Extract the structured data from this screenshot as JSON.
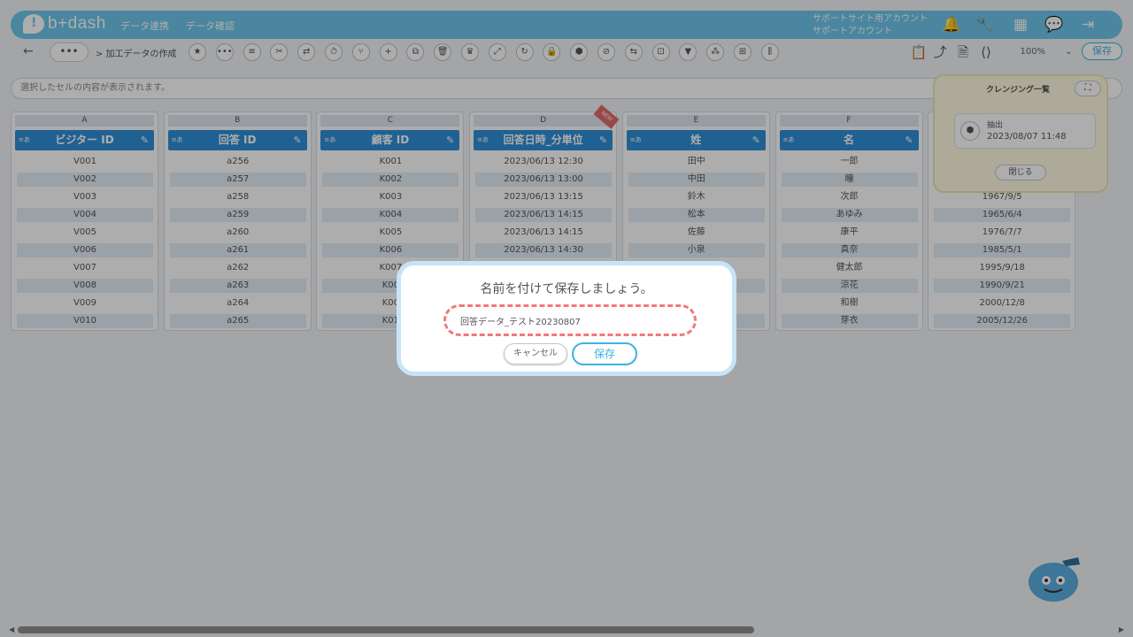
{
  "header": {
    "logo_text": "b+dash",
    "nav": [
      "データ連携",
      "データ確認"
    ],
    "account_line1": "サポートサイト用アカウント",
    "account_line2": "サポートアカウント"
  },
  "toolbar": {
    "back": "←",
    "more": "•••",
    "breadcrumb": "> 加工データの作成",
    "zoom": "100%",
    "save_label": "保存",
    "tool_icons": [
      "star-icon",
      "more-icon",
      "list-icon",
      "scissors-icon",
      "split-icon",
      "timer-icon",
      "merge-icon",
      "plus-icon",
      "copy-icon",
      "trash-icon",
      "crown-icon",
      "expand-icon",
      "repeat-icon",
      "lock-icon",
      "box-icon",
      "cancel-icon",
      "swap-icon",
      "grid-icon",
      "filter-icon",
      "pattern-icon",
      "table-icon",
      "columns-icon"
    ]
  },
  "cellbar": {
    "placeholder": "選択したセルの内容が表示されます。"
  },
  "columns": [
    {
      "letter": "A",
      "kind": "A",
      "name": "ビジター ID",
      "values": [
        "V001",
        "V002",
        "V003",
        "V004",
        "V005",
        "V006",
        "V007",
        "V008",
        "V009",
        "V010"
      ]
    },
    {
      "letter": "B",
      "kind": "A",
      "name": "回答 ID",
      "values": [
        "a256",
        "a257",
        "a258",
        "a259",
        "a260",
        "a261",
        "a262",
        "a263",
        "a264",
        "a265"
      ]
    },
    {
      "letter": "C",
      "kind": "A",
      "name": "顧客 ID",
      "values": [
        "K001",
        "K002",
        "K003",
        "K004",
        "K005",
        "K006",
        "K007",
        "K00",
        "K00",
        "K01"
      ]
    },
    {
      "letter": "D",
      "kind": "A",
      "name": "回答日時_分単位",
      "new_badge": "NEW",
      "values": [
        "2023/06/13 12:30",
        "2023/06/13 13:00",
        "2023/06/13 13:15",
        "2023/06/13 14:15",
        "2023/06/13 14:15",
        "2023/06/13 14:30",
        "",
        "",
        "",
        ""
      ]
    },
    {
      "letter": "E",
      "kind": "A",
      "name": "姓",
      "values": [
        "田中",
        "中田",
        "鈴木",
        "松本",
        "佐藤",
        "小泉",
        "",
        "",
        "",
        ""
      ]
    },
    {
      "letter": "F",
      "kind": "A",
      "name": "名",
      "values": [
        "一郎",
        "瞳",
        "次郎",
        "あゆみ",
        "康平",
        "真奈",
        "健太郎",
        "涼花",
        "和樹",
        "芽衣"
      ]
    },
    {
      "letter": "",
      "kind": "",
      "name": "",
      "values": [
        "",
        "",
        "1967/9/5",
        "1965/6/4",
        "1976/7/7",
        "1985/5/1",
        "1995/9/18",
        "1990/9/21",
        "2000/12/8",
        "2005/12/26"
      ]
    }
  ],
  "cleansing": {
    "title": "クレンジング一覧",
    "expand": "⛶",
    "item_name": "抽出",
    "item_date": "2023/08/07 11:48",
    "close_label": "閉じる"
  },
  "dialog": {
    "title": "名前を付けて保存しましょう。",
    "input_value": "回答データ_テスト20230807",
    "cancel_label": "キャンセル",
    "save_label": "保存"
  },
  "colors": {
    "header": "#6ec6ea",
    "accent": "#3bb3e3",
    "column_head": "#2f8fd8",
    "highlight": "#f07a7a"
  }
}
